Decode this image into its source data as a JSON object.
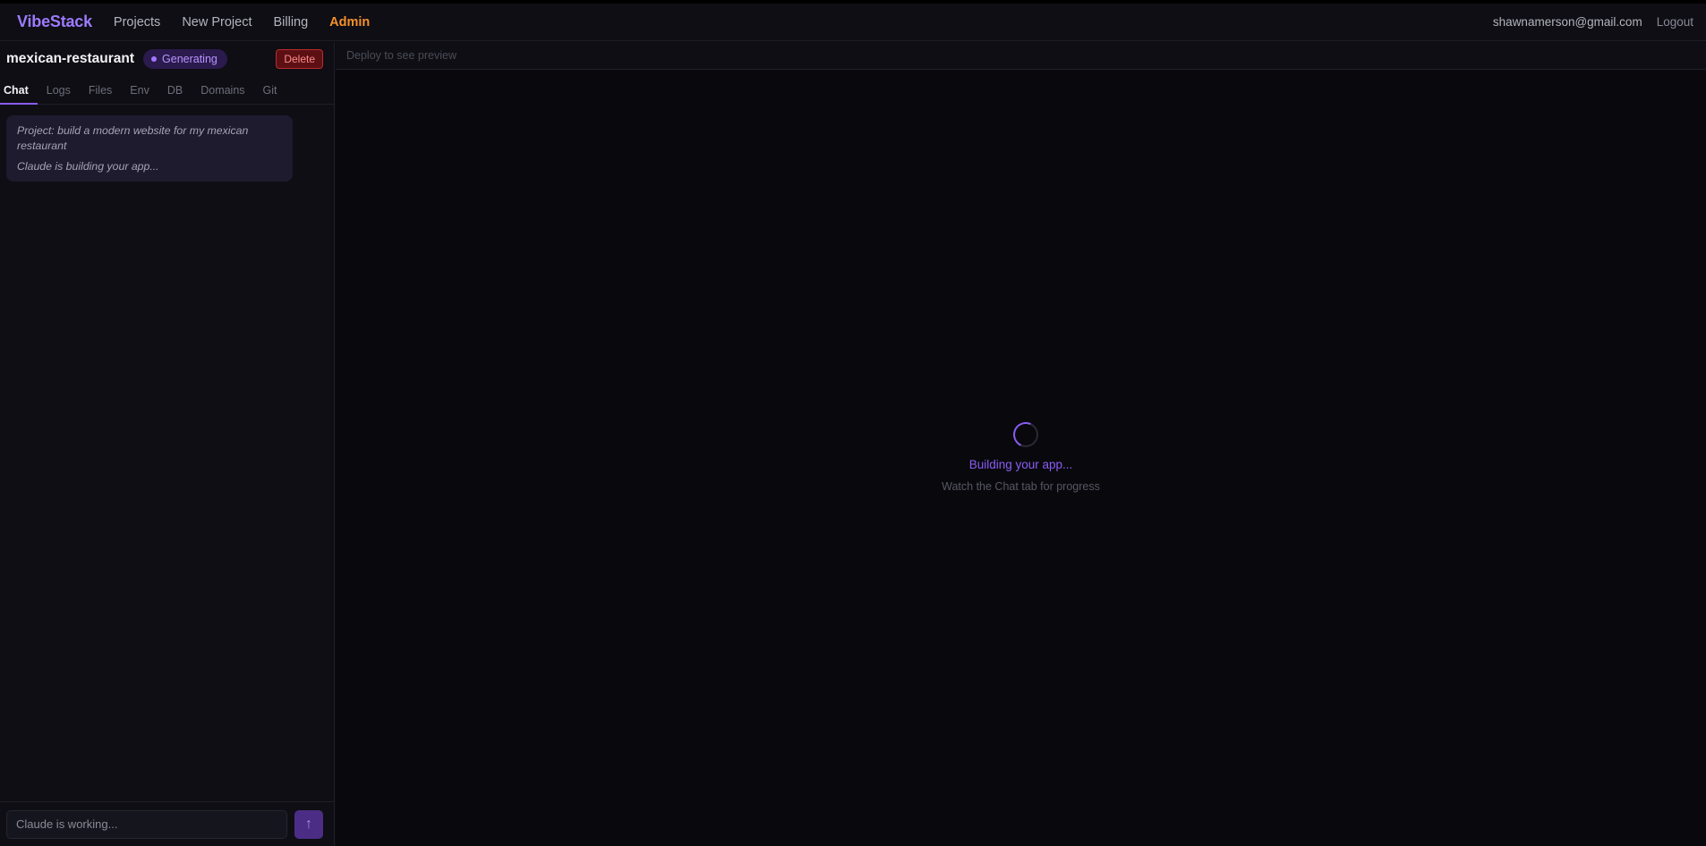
{
  "header": {
    "brand": "VibeStack",
    "nav": [
      "Projects",
      "New Project",
      "Billing"
    ],
    "admin": "Admin",
    "user_email": "shawnamerson@gmail.com",
    "logout": "Logout"
  },
  "project": {
    "name": "mexican-restaurant",
    "status": "Generating",
    "delete_label": "Delete"
  },
  "tabs": [
    "Chat",
    "Logs",
    "Files",
    "Env",
    "DB",
    "Domains",
    "Git"
  ],
  "active_tab": "Chat",
  "chat": {
    "messages": [
      "Project: build a modern website for my mexican restaurant",
      "Claude is building your app..."
    ]
  },
  "composer": {
    "placeholder": "Claude is working...",
    "send_icon": "arrow-up-icon"
  },
  "preview": {
    "bar_text": "Deploy to see preview",
    "loading_title": "Building your app...",
    "loading_subtitle": "Watch the Chat tab for progress"
  },
  "colors": {
    "accent": "#8b5cf6",
    "admin": "#f5902a",
    "danger": "#b92b2b"
  }
}
